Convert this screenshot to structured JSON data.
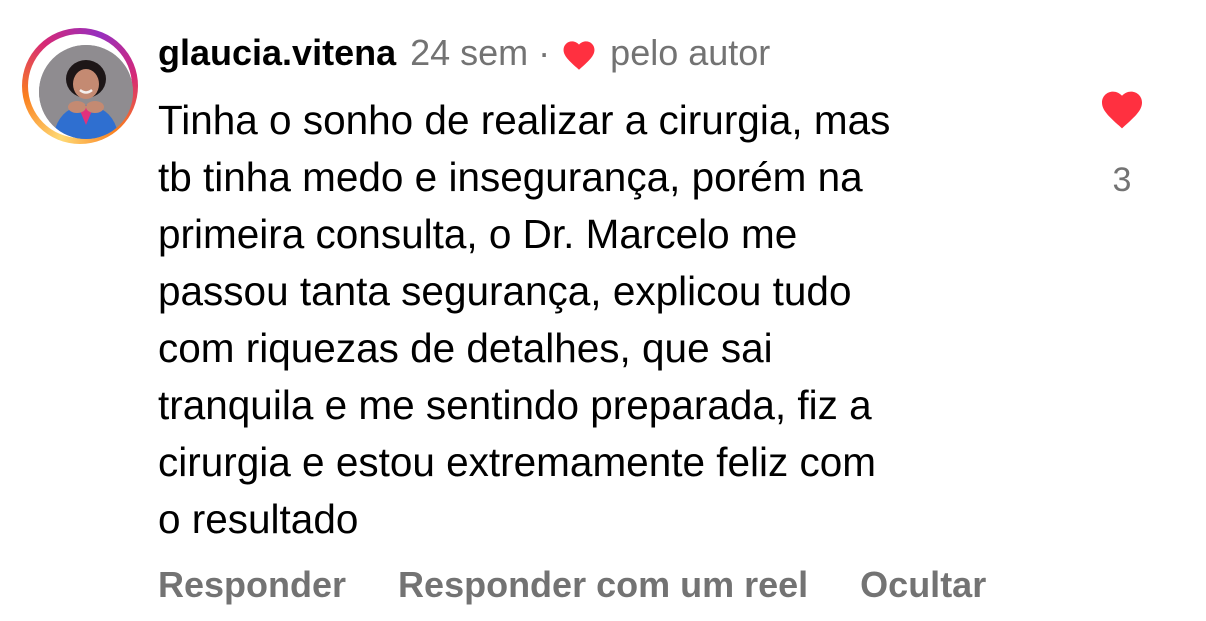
{
  "comment": {
    "username": "glaucia.vitena",
    "time": "24 sem",
    "separator": "·",
    "author_liked_label": "pelo autor",
    "body_lines": [
      "Tinha o sonho de realizar a cirurgia, mas",
      "tb tinha medo e insegurança, porém na",
      "primeira consulta, o Dr. Marcelo me",
      "passou tanta segurança, explicou tudo",
      "com riquezas de detalhes, que sai",
      "tranquila e me sentindo preparada, fiz a",
      "cirurgia e estou extremamente feliz com",
      "o resultado"
    ],
    "like_count": "3",
    "liked": true
  },
  "actions": {
    "reply": "Responder",
    "reply_reel": "Responder com um reel",
    "hide": "Ocultar"
  },
  "colors": {
    "heart": "#ff3040",
    "secondary_text": "#737373",
    "primary_text": "#000000"
  },
  "icons": {
    "author_heart": "heart-icon",
    "like": "heart-filled-icon"
  }
}
